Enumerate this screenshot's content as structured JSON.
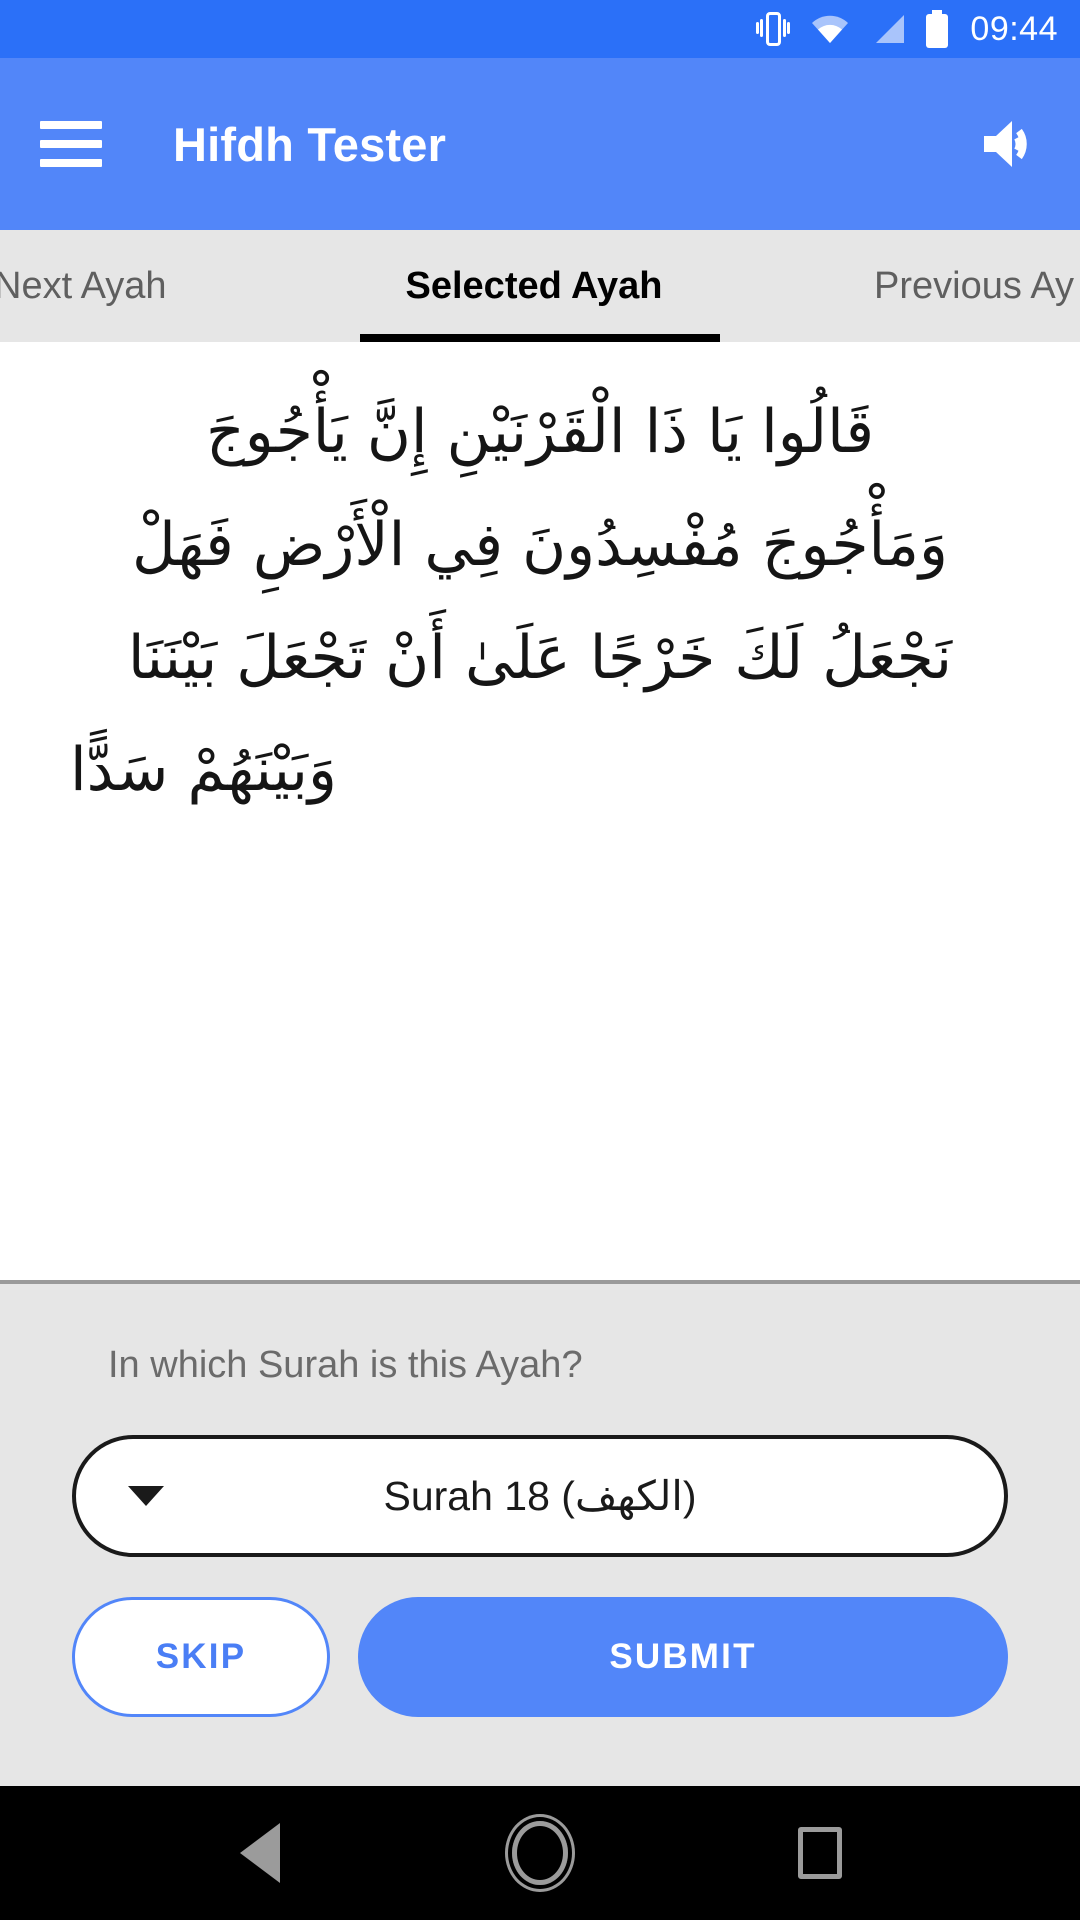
{
  "status_bar": {
    "clock": "09:44",
    "icons": [
      "vibrate-icon",
      "wifi-icon",
      "signal-icon",
      "battery-icon"
    ],
    "background_color": "#2b70f8"
  },
  "app_bar": {
    "title": "Hifdh Tester",
    "menu_icon": "hamburger-menu-icon",
    "action_icon": "volume-up-icon",
    "background_color": "#5286f9"
  },
  "tabs": {
    "items": [
      {
        "label": "Next Ayah",
        "active": false
      },
      {
        "label": "Selected Ayah",
        "active": true
      },
      {
        "label": "Previous Ay",
        "active": false
      }
    ],
    "indicator_color": "#000000",
    "background_color": "#e6e6e6"
  },
  "ayah": {
    "lines": [
      "قَالُوا يَا ذَا الْقَرْنَيْنِ إِنَّ يَأْجُوجَ",
      "وَمَأْجُوجَ مُفْسِدُونَ فِي الْأَرْضِ فَهَلْ",
      "نَجْعَلُ لَكَ خَرْجًا عَلَىٰ أَنْ تَجْعَلَ بَيْنَنَا",
      "وَبَيْنَهُمْ سَدًّا"
    ]
  },
  "question_panel": {
    "prompt": "In which Surah is this Ayah?",
    "dropdown": {
      "selected_value": "Surah 18 (الكهف)",
      "caret_icon": "chevron-down-icon"
    },
    "skip_label": "SKIP",
    "submit_label": "SUBMIT",
    "accent_color": "#5286f9",
    "background_color": "#e6e6e6"
  },
  "nav_bar": {
    "back_icon": "back-triangle-icon",
    "home_icon": "home-circle-icon",
    "recents_icon": "recents-square-icon",
    "background_color": "#000000"
  }
}
